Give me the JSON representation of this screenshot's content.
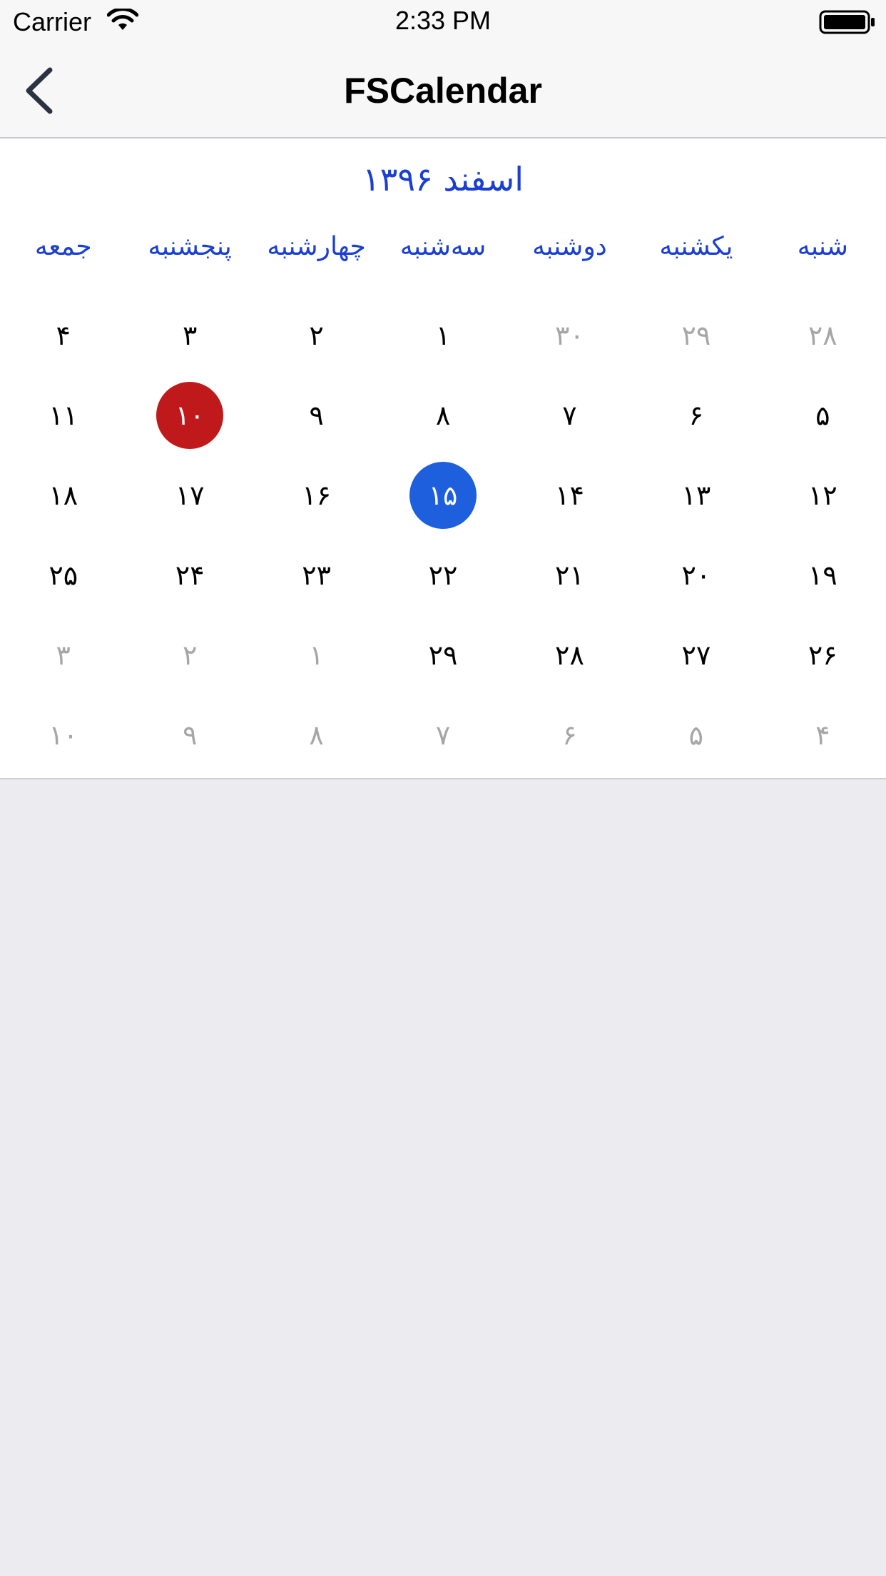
{
  "status_bar": {
    "carrier": "Carrier",
    "time": "2:33 PM"
  },
  "nav": {
    "title": "FSCalendar",
    "back_icon": "chevron-left-icon"
  },
  "calendar": {
    "month_title": "اسفند ۱۳۹۶",
    "weekdays": [
      "شنبه",
      "یکشنبه",
      "دوشنبه",
      "سه‌شنبه",
      "چهارشنبه",
      "پنجشنبه",
      "جمعه"
    ],
    "accent_color": "#1a3fd1",
    "today_color": "#c0191c",
    "selected_color": "#1d5fdc",
    "weeks": [
      [
        {
          "label": "۲۸",
          "state": "outside"
        },
        {
          "label": "۲۹",
          "state": "outside"
        },
        {
          "label": "۳۰",
          "state": "outside"
        },
        {
          "label": "۱",
          "state": "normal"
        },
        {
          "label": "۲",
          "state": "normal"
        },
        {
          "label": "۳",
          "state": "normal"
        },
        {
          "label": "۴",
          "state": "normal"
        }
      ],
      [
        {
          "label": "۵",
          "state": "normal"
        },
        {
          "label": "۶",
          "state": "normal"
        },
        {
          "label": "۷",
          "state": "normal"
        },
        {
          "label": "۸",
          "state": "normal"
        },
        {
          "label": "۹",
          "state": "normal"
        },
        {
          "label": "۱۰",
          "state": "today"
        },
        {
          "label": "۱۱",
          "state": "normal"
        }
      ],
      [
        {
          "label": "۱۲",
          "state": "normal"
        },
        {
          "label": "۱۳",
          "state": "normal"
        },
        {
          "label": "۱۴",
          "state": "normal"
        },
        {
          "label": "۱۵",
          "state": "selected"
        },
        {
          "label": "۱۶",
          "state": "normal"
        },
        {
          "label": "۱۷",
          "state": "normal"
        },
        {
          "label": "۱۸",
          "state": "normal"
        }
      ],
      [
        {
          "label": "۱۹",
          "state": "normal"
        },
        {
          "label": "۲۰",
          "state": "normal"
        },
        {
          "label": "۲۱",
          "state": "normal"
        },
        {
          "label": "۲۲",
          "state": "normal"
        },
        {
          "label": "۲۳",
          "state": "normal"
        },
        {
          "label": "۲۴",
          "state": "normal"
        },
        {
          "label": "۲۵",
          "state": "normal"
        }
      ],
      [
        {
          "label": "۲۶",
          "state": "normal"
        },
        {
          "label": "۲۷",
          "state": "normal"
        },
        {
          "label": "۲۸",
          "state": "normal"
        },
        {
          "label": "۲۹",
          "state": "normal"
        },
        {
          "label": "۱",
          "state": "outside"
        },
        {
          "label": "۲",
          "state": "outside"
        },
        {
          "label": "۳",
          "state": "outside"
        }
      ],
      [
        {
          "label": "۴",
          "state": "outside"
        },
        {
          "label": "۵",
          "state": "outside"
        },
        {
          "label": "۶",
          "state": "outside"
        },
        {
          "label": "۷",
          "state": "outside"
        },
        {
          "label": "۸",
          "state": "outside"
        },
        {
          "label": "۹",
          "state": "outside"
        },
        {
          "label": "۱۰",
          "state": "outside"
        }
      ]
    ]
  }
}
